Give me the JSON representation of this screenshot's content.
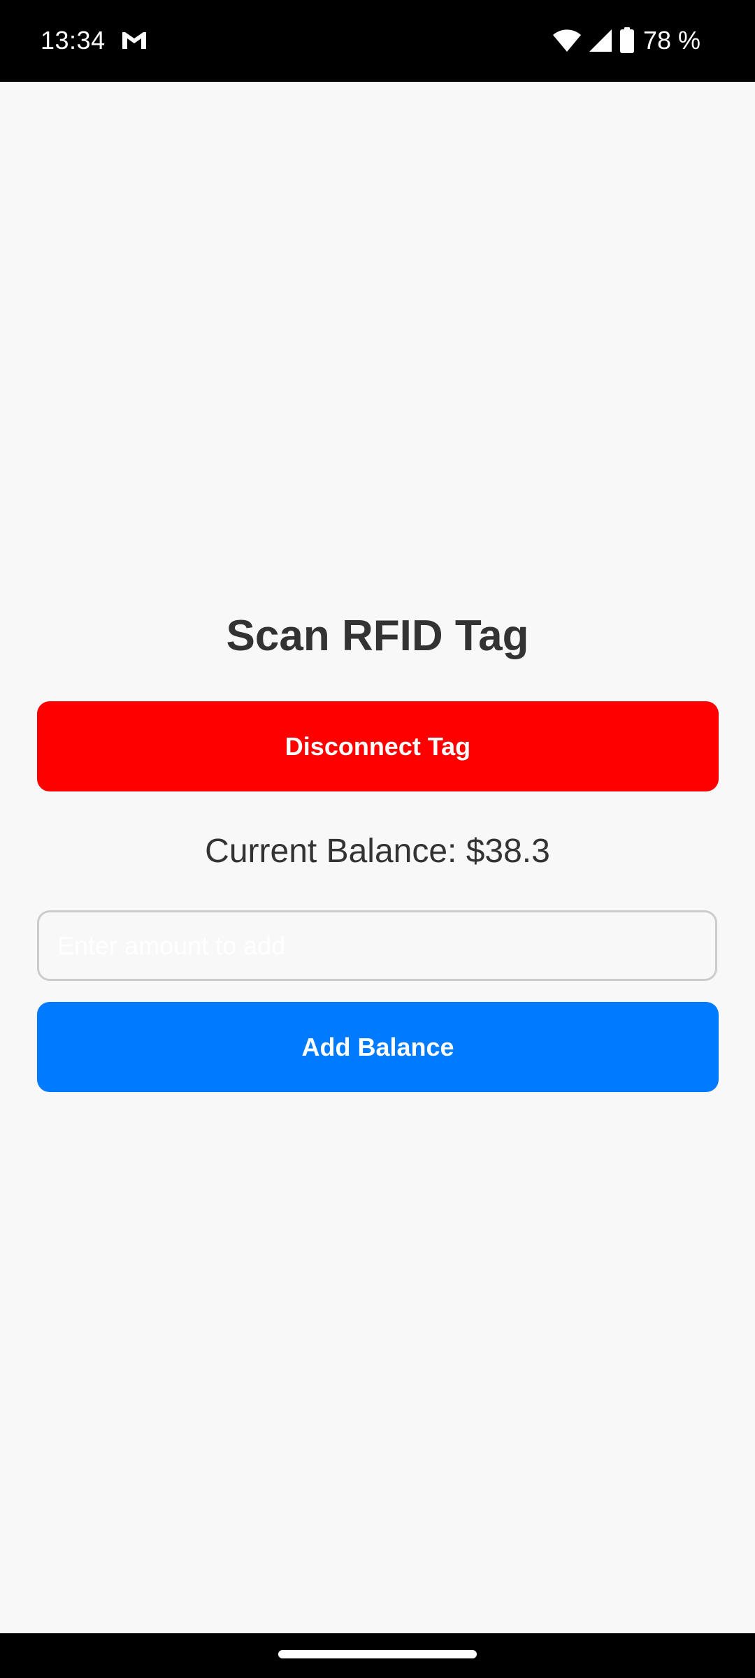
{
  "status_bar": {
    "time": "13:34",
    "battery": "78 %",
    "notification_icon": "gmail-icon",
    "icons": [
      "wifi-icon",
      "cell-signal-icon",
      "battery-icon"
    ]
  },
  "main": {
    "title": "Scan RFID Tag",
    "disconnect_label": "Disconnect Tag",
    "balance_text": "Current Balance: $38.3",
    "amount_input": {
      "value": "",
      "placeholder": "Enter amount to add"
    },
    "add_balance_label": "Add Balance"
  },
  "colors": {
    "disconnect_button": "#ff0000",
    "add_button": "#007bff",
    "background": "#f8f8f8",
    "text": "#333333"
  }
}
